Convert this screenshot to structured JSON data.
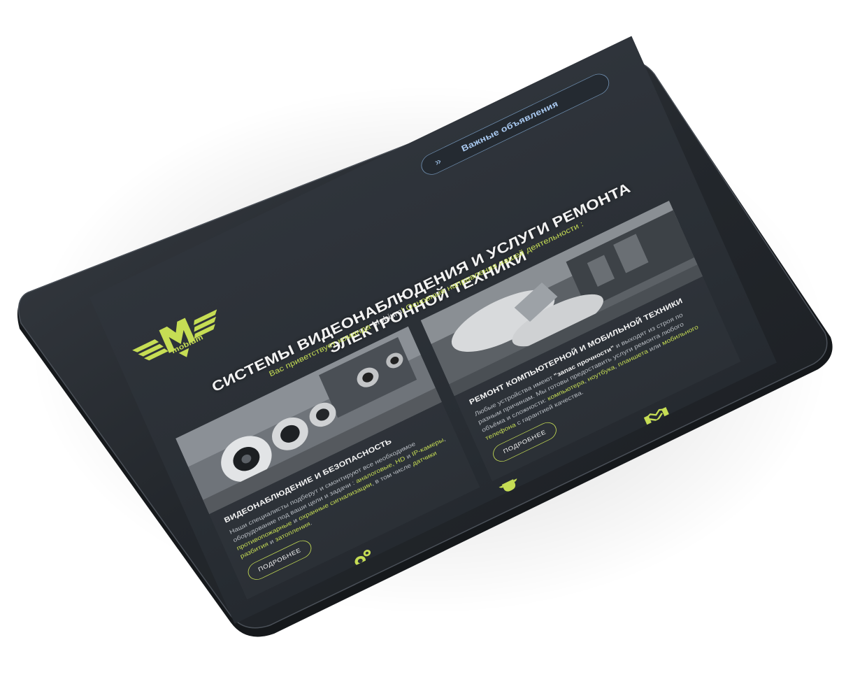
{
  "notice": {
    "label": "Важные объявления",
    "chevron": "»"
  },
  "logo": {
    "letter": "M",
    "sub": "mobium",
    "icon": "mobium-wings-logo"
  },
  "hero": {
    "title": "СИСТЕМЫ ВИДЕОНАБЛЮДЕНИЯ И УСЛУГИ РЕМОНТА ЭЛЕКТРОННОЙ ТЕХНИКИ",
    "welcome_pre": "Вас приветствует команда ",
    "welcome_brand": "Mobium",
    "welcome_post": "! Основные направления нашей деятельности :"
  },
  "cards": [
    {
      "title": "ВИДЕОНАБЛЮДЕНИЕ И БЕЗОПАСНОСТЬ",
      "text_1": "Наши специалисты подберут и смонтируют все необходимое оборудование под ваши цели и задачи : ",
      "hl_1": "аналоговые, HD",
      "text_2": " и ",
      "hl_2": "IP-камеры",
      "text_3": ", ",
      "hl_3": "противопожарные",
      "text_4": " и ",
      "hl_4": "охранные сигнализации",
      "text_5": ", в том числе ",
      "hl_5": "датчики разбития",
      "text_6": " и ",
      "hl_6": "затопления",
      "text_7": ".",
      "button": "ПОДРОБНЕЕ"
    },
    {
      "title": "РЕМОНТ КОМПЬЮТЕРНОЙ И МОБИЛЬНОЙ ТЕХНИКИ",
      "text_1": "Любые устройства имеют ",
      "bold_1": "\"запас прочности\"",
      "text_2": " и выходят из строя по разным причинам. Мы готовы предоставить услуги ремонта любого объёма и сложности: ",
      "hl_1": "компьютера",
      "text_3": ", ",
      "hl_2": "ноутбука",
      "text_4": ", ",
      "hl_3": "планшета",
      "text_5": " или ",
      "hl_4": "мобильного телефона",
      "text_6": " с гарантией качества.",
      "button": "ПОДРОБНЕЕ"
    }
  ],
  "icons": [
    "gears-icon",
    "trophy-icon",
    "handshake-icon"
  ],
  "colors": {
    "accent": "#c6dd54",
    "screen_bg": "#2d3238",
    "bezel": "#23262b",
    "notice_border": "#6f8fb0"
  }
}
